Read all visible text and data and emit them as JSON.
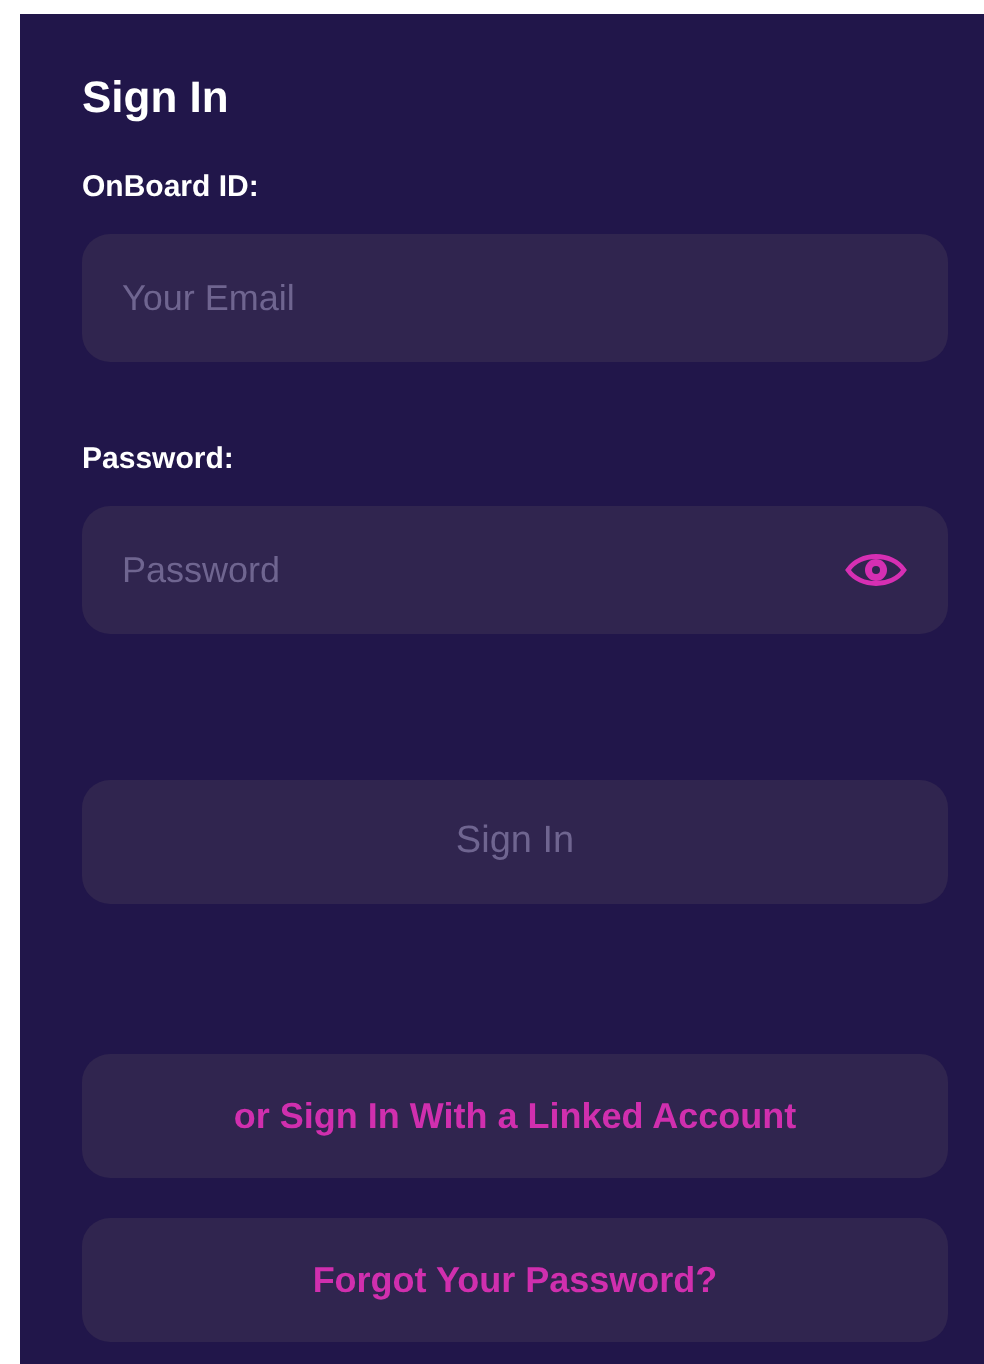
{
  "title": "Sign In",
  "fields": [
    {
      "label": "OnBoard ID:",
      "placeholder": "Your Email",
      "kind": "email"
    },
    {
      "label": "Password:",
      "placeholder": "Password",
      "kind": "password"
    }
  ],
  "sign_in_button": {
    "label": "Sign In",
    "disabled": true
  },
  "links": [
    {
      "label": "or Sign In With a Linked Account"
    },
    {
      "label": "Forgot Your Password?"
    }
  ]
}
